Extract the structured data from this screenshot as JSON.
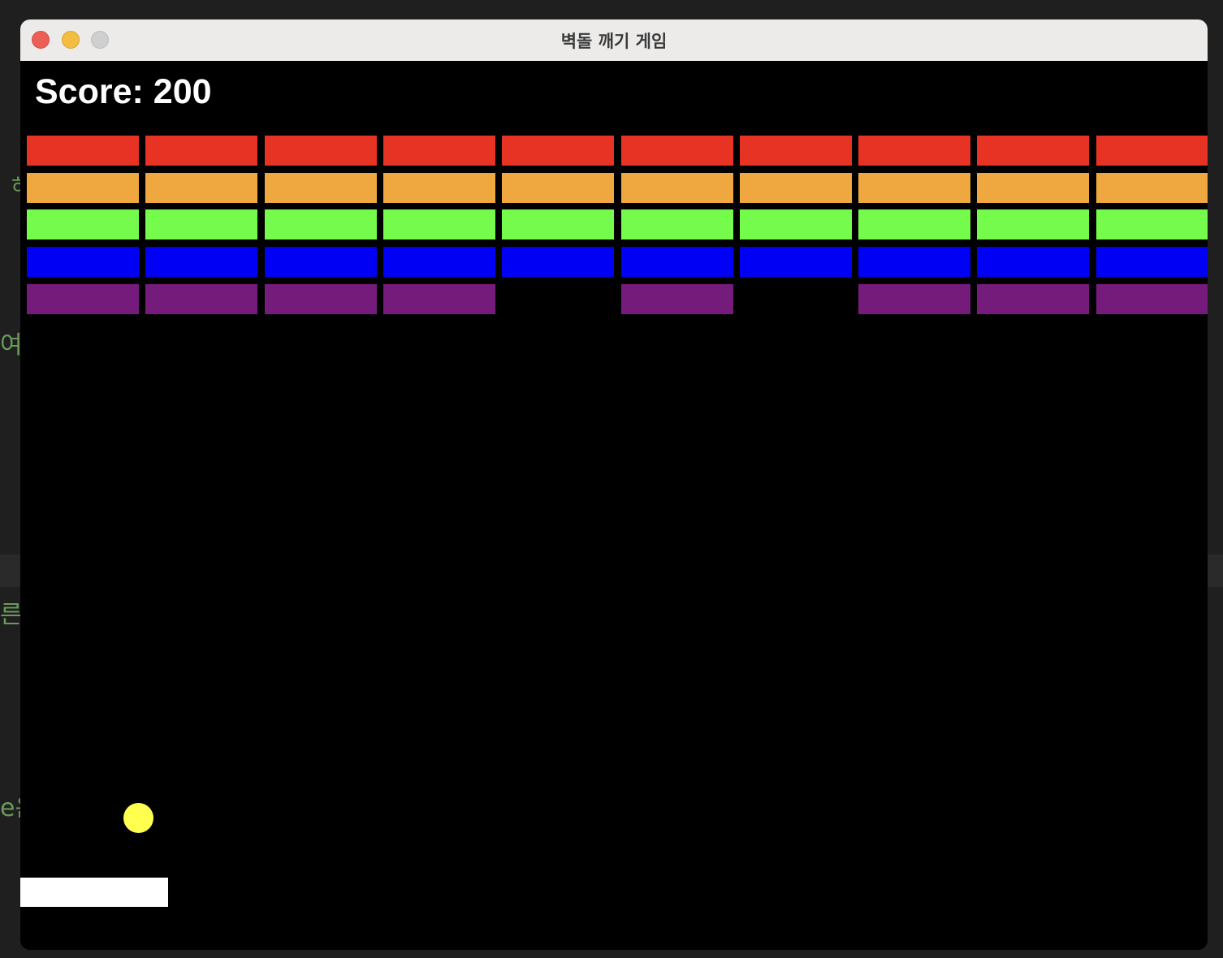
{
  "window": {
    "title": "벽돌 깨기 게임"
  },
  "game": {
    "score_label": "Score:",
    "score": 200,
    "columns": 10,
    "rows": [
      {
        "color": "#e63323",
        "bricks": [
          1,
          1,
          1,
          1,
          1,
          1,
          1,
          1,
          1,
          1
        ]
      },
      {
        "color": "#efa83f",
        "bricks": [
          1,
          1,
          1,
          1,
          1,
          1,
          1,
          1,
          1,
          1
        ]
      },
      {
        "color": "#75fb4c",
        "bricks": [
          1,
          1,
          1,
          1,
          1,
          1,
          1,
          1,
          1,
          1
        ]
      },
      {
        "color": "#0000f5",
        "bricks": [
          1,
          1,
          1,
          1,
          1,
          1,
          1,
          1,
          1,
          1
        ]
      },
      {
        "color": "#741b7c",
        "bricks": [
          1,
          1,
          1,
          1,
          0,
          1,
          0,
          1,
          1,
          1
        ]
      }
    ],
    "ball_color": "#ffff4f",
    "paddle_color": "#ffffff"
  },
  "background_fragments": [
    "하",
    "여",
    "른",
    "e은"
  ]
}
